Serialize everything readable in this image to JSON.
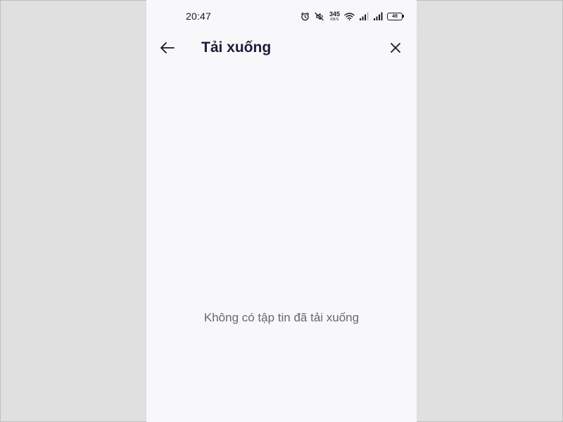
{
  "status_bar": {
    "time": "20:47",
    "net_speed_value": "345",
    "net_speed_unit": "KB/S",
    "battery_level": "49",
    "icons": [
      "alarm-icon",
      "mute-icon",
      "wifi-icon",
      "signal-icon",
      "signal-icon",
      "battery-icon"
    ]
  },
  "app_bar": {
    "title": "Tải xuống",
    "back_icon": "arrow-left-icon",
    "close_icon": "close-icon"
  },
  "content": {
    "empty_message": "Không có tập tin đã tải xuống"
  },
  "colors": {
    "page_background": "#e0e0e0",
    "screen_background": "#f8f8fa",
    "title_color": "#221a3a",
    "message_color": "#666670"
  }
}
